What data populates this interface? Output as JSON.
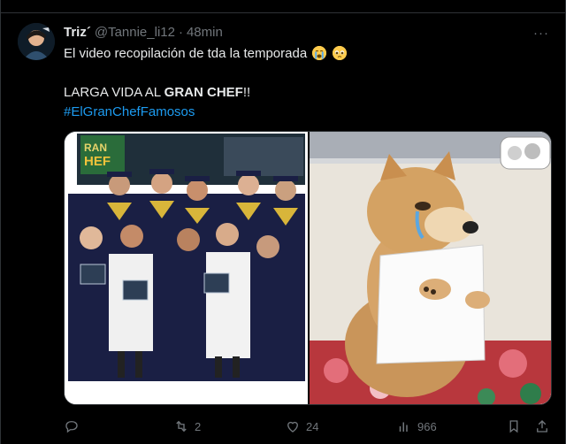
{
  "tweet": {
    "author_name": "Triz´",
    "handle": "@Tannie_li12",
    "dot": "·",
    "time": "48min",
    "text_line1": "El video recopilación de tda la temporada",
    "text_line2_prefix": "LARGA VIDA AL ",
    "text_line2_bold": "GRAN CHEF",
    "text_line2_suffix": "!!",
    "hashtag": "#ElGranChefFamosos",
    "more_label": "···"
  },
  "actions": {
    "reply_count": "",
    "retweet_count": "2",
    "like_count": "24",
    "views_count": "966"
  },
  "icons": {
    "reply": "reply-icon",
    "retweet": "retweet-icon",
    "like": "heart-icon",
    "views": "views-icon",
    "bookmark": "bookmark-icon",
    "share": "share-icon"
  },
  "colors": {
    "background": "#000000",
    "text": "#e7e9ea",
    "muted": "#71767b",
    "link": "#1d9bf0"
  }
}
